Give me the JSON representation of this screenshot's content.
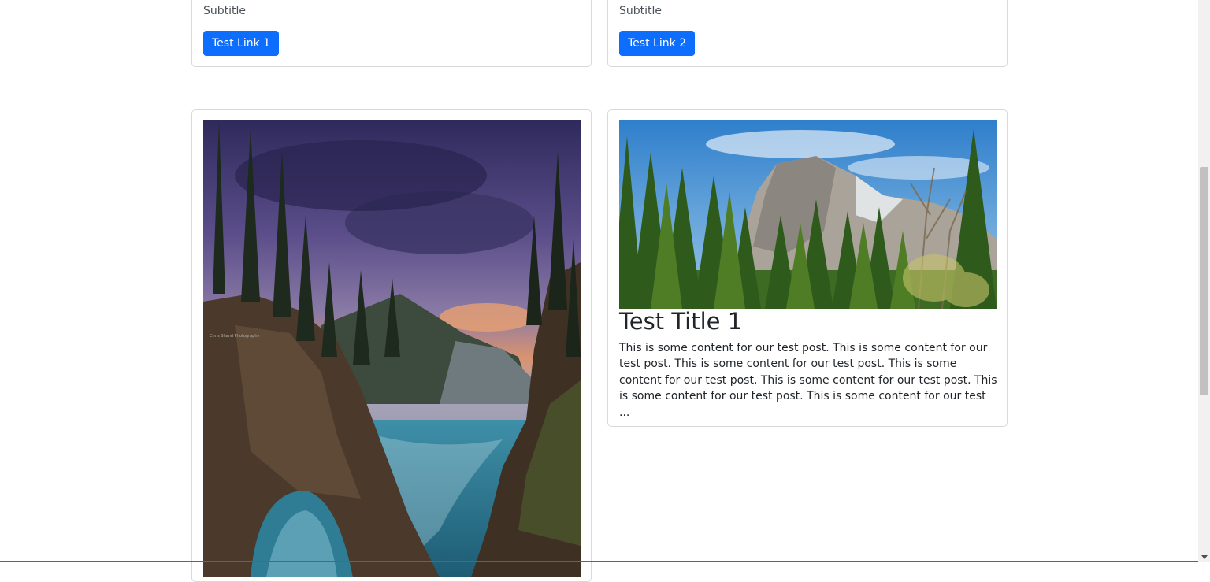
{
  "cards_top": [
    {
      "subtitle": "Subtitle",
      "link_label": "Test Link 1"
    },
    {
      "subtitle": "Subtitle",
      "link_label": "Test Link 2"
    }
  ],
  "post": {
    "title": "Test Title 1",
    "content": "This is some content for our test post. This is some content for our test post. This is some content for our test post. This is some content for our test post. This is some content for our test post. This is some content for our test post. This is some content for our test ..."
  },
  "colors": {
    "button_bg": "#0d6efd",
    "border": "rgba(0,0,0,0.15)"
  }
}
